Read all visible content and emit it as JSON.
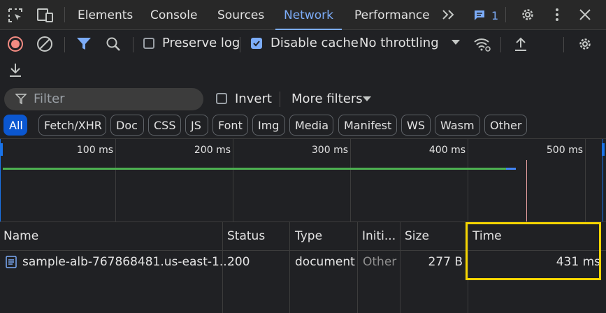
{
  "tabs": {
    "items": [
      "Elements",
      "Console",
      "Sources",
      "Network",
      "Performance"
    ],
    "active": "Network",
    "issues_count": "1"
  },
  "toolbar": {
    "preserve_log_label": "Preserve log",
    "disable_cache_label": "Disable cache",
    "throttling_value": "No throttling",
    "preserve_log_checked": false,
    "disable_cache_checked": true
  },
  "filter": {
    "placeholder": "Filter",
    "invert_label": "Invert",
    "more_filters_label": "More filters"
  },
  "type_filters": [
    "All",
    "Fetch/XHR",
    "Doc",
    "CSS",
    "JS",
    "Font",
    "Img",
    "Media",
    "Manifest",
    "WS",
    "Wasm",
    "Other"
  ],
  "timeline": {
    "ticks": [
      "100 ms",
      "200 ms",
      "300 ms",
      "400 ms",
      "500 ms"
    ]
  },
  "table": {
    "columns": [
      "Name",
      "Status",
      "Type",
      "Initi...",
      "Size",
      "Time"
    ],
    "rows": [
      {
        "name": "sample-alb-767868481.us-east-1....",
        "status": "200",
        "type": "document",
        "initiator": "Other",
        "size": "277 B",
        "time": "431 ms"
      }
    ]
  },
  "colors": {
    "background": "#202124",
    "accent": "#7cacf8",
    "record_red": "#f28b82",
    "timing_green": "#4caf50",
    "highlight_yellow": "#f4d400"
  }
}
